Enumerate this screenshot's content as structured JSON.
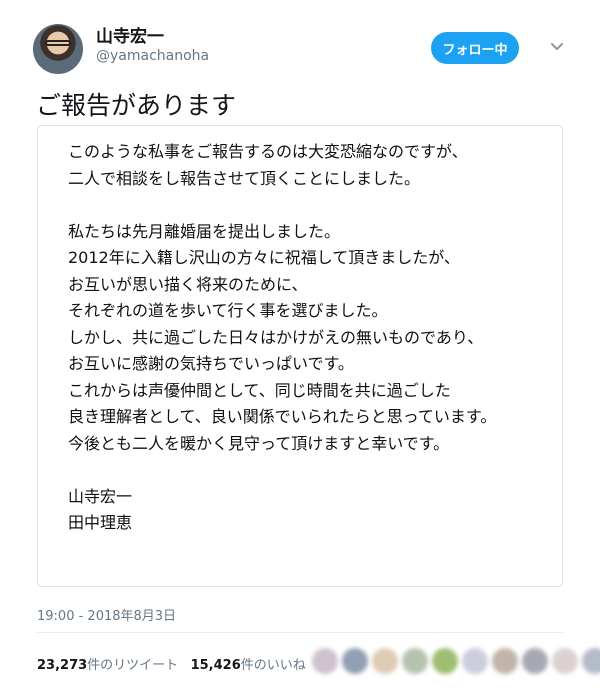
{
  "user": {
    "name": "山寺宏一",
    "handle": "@yamachanoha"
  },
  "follow_button": "フォロー中",
  "tweet": {
    "title": "ご報告があります",
    "card_lines": [
      "このような私事をご報告するのは大変恐縮なのですが、",
      "二人で相談をし報告させて頂くことにしました。",
      "",
      "私たちは先月離婚届を提出しました。",
      "2012年に入籍し沢山の方々に祝福して頂きましたが、",
      "お互いが思い描く将来のために、",
      "それぞれの道を歩いて行く事を選びました。",
      "しかし、共に過ごした日々はかけがえの無いものであり、",
      "お互いに感謝の気持ちでいっぱいです。",
      "これからは声優仲間として、同じ時間を共に過ごした",
      "良き理解者として、良い関係でいられたらと思っています。",
      "今後とも二人を暖かく見守って頂けますと幸いです。",
      "",
      "山寺宏一",
      "田中理恵"
    ],
    "timestamp": "19:00 - 2018年8月3日"
  },
  "stats": {
    "retweets_count": "23,273",
    "retweets_label": "件のリツイート",
    "likes_count": "15,426",
    "likes_label": "件のいいね"
  },
  "liker_colors": [
    "#c9b7c4",
    "#7f8fa8",
    "#d9c2a6",
    "#a9b9a0",
    "#8fb35a",
    "#c4c4d8",
    "#b7a79a",
    "#9a9aa8",
    "#d8c8c8",
    "#a8b0c0"
  ]
}
